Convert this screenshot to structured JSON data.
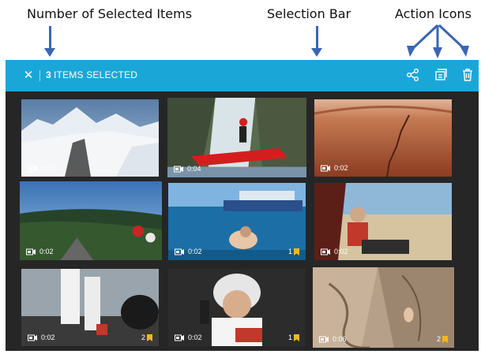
{
  "annotations": {
    "count_label": "Number of Selected Items",
    "bar_label": "Selection Bar",
    "icons_label": "Action Icons"
  },
  "selection_bar": {
    "count": "3",
    "label": "ITEMS SELECTED",
    "close_icon": "close-icon",
    "actions": [
      "share-icon",
      "export-icon",
      "delete-icon"
    ]
  },
  "colors": {
    "bar": "#1aa7d8",
    "panel": "#262626",
    "selected_outline": "#1aa7d8",
    "hilight": "#f2b817"
  },
  "tiles": [
    {
      "duration": "0:03",
      "selected": false,
      "hilights": ""
    },
    {
      "duration": "0:04",
      "selected": true,
      "hilights": ""
    },
    {
      "duration": "0:02",
      "selected": false,
      "hilights": ""
    },
    {
      "duration": "0:02",
      "selected": true,
      "hilights": ""
    },
    {
      "duration": "0:02",
      "selected": false,
      "hilights": "1"
    },
    {
      "duration": "0:02",
      "selected": false,
      "hilights": ""
    },
    {
      "duration": "0:02",
      "selected": false,
      "hilights": "2"
    },
    {
      "duration": "0:02",
      "selected": false,
      "hilights": "1"
    },
    {
      "duration": "0:06",
      "selected": true,
      "hilights": "2"
    }
  ]
}
